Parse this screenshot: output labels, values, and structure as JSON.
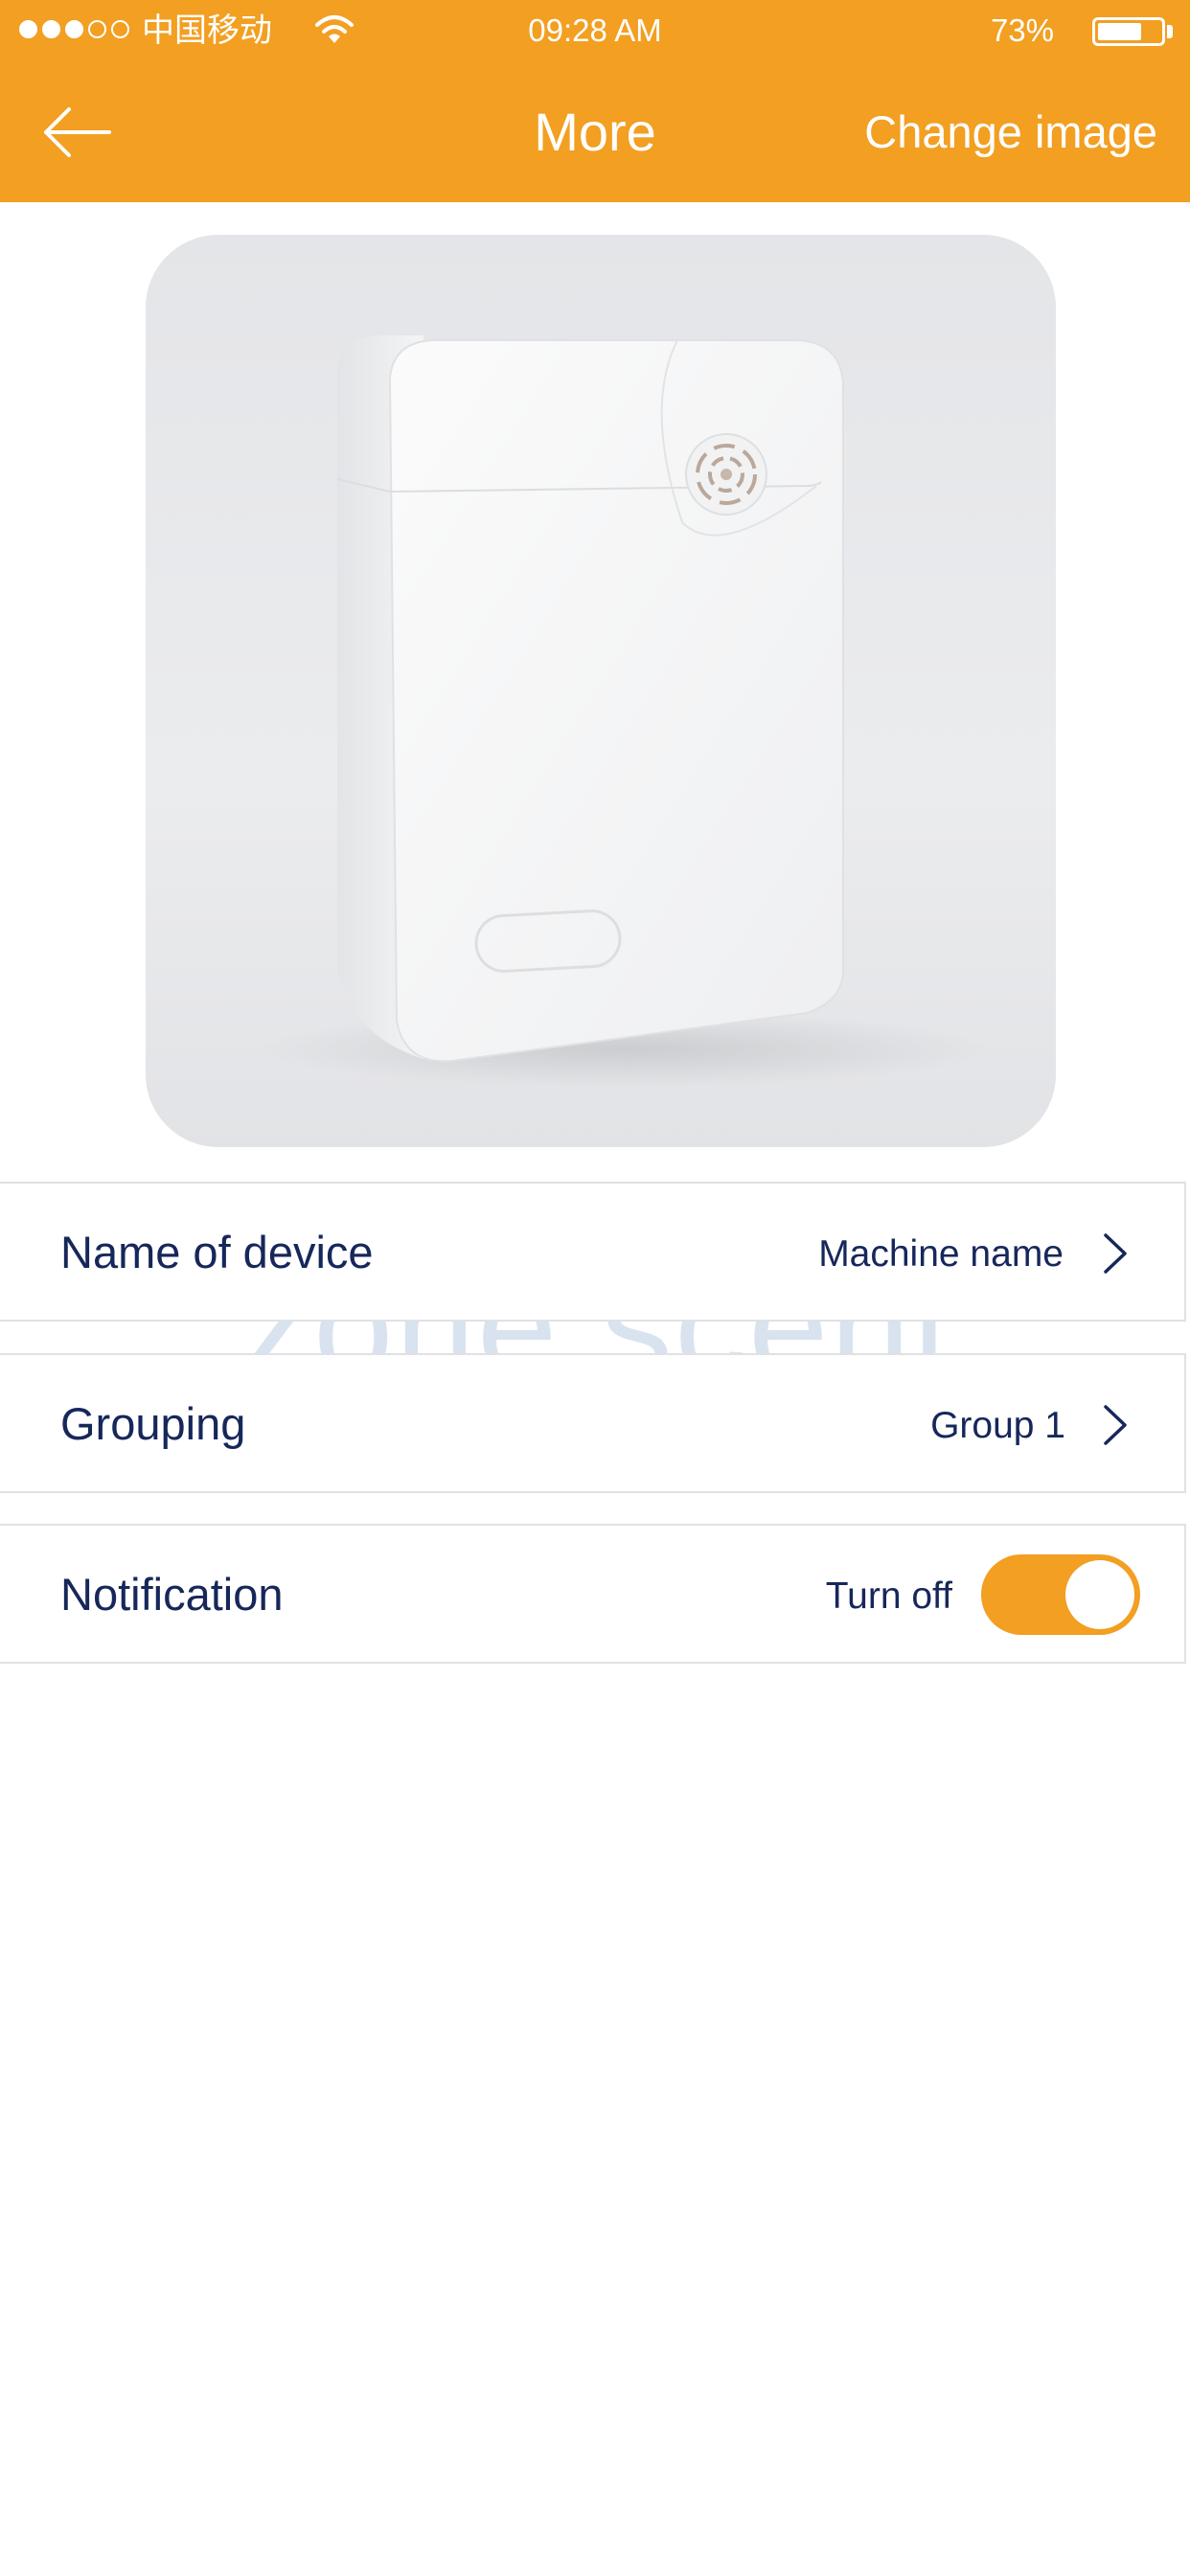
{
  "status_bar": {
    "carrier": "中国移动",
    "time": "09:28 AM",
    "battery_percent": "73%",
    "battery_level": 0.73,
    "signal_bars_filled": 3,
    "signal_bars_total": 5
  },
  "nav": {
    "back_icon": "arrow-left-icon",
    "title": "More",
    "change_image_label": "Change image"
  },
  "device_photo": {
    "watermark": "zone scent"
  },
  "settings": {
    "name_of_device": {
      "label": "Name of device",
      "value": "Machine name"
    },
    "grouping": {
      "label": "Grouping",
      "value": "Group 1"
    },
    "notification": {
      "label": "Notification",
      "value": "Turn off",
      "enabled": true
    }
  },
  "colors": {
    "accent": "#f29f22",
    "text_primary": "#16275a",
    "divider": "#dfe1e5",
    "background": "#ffffff"
  }
}
